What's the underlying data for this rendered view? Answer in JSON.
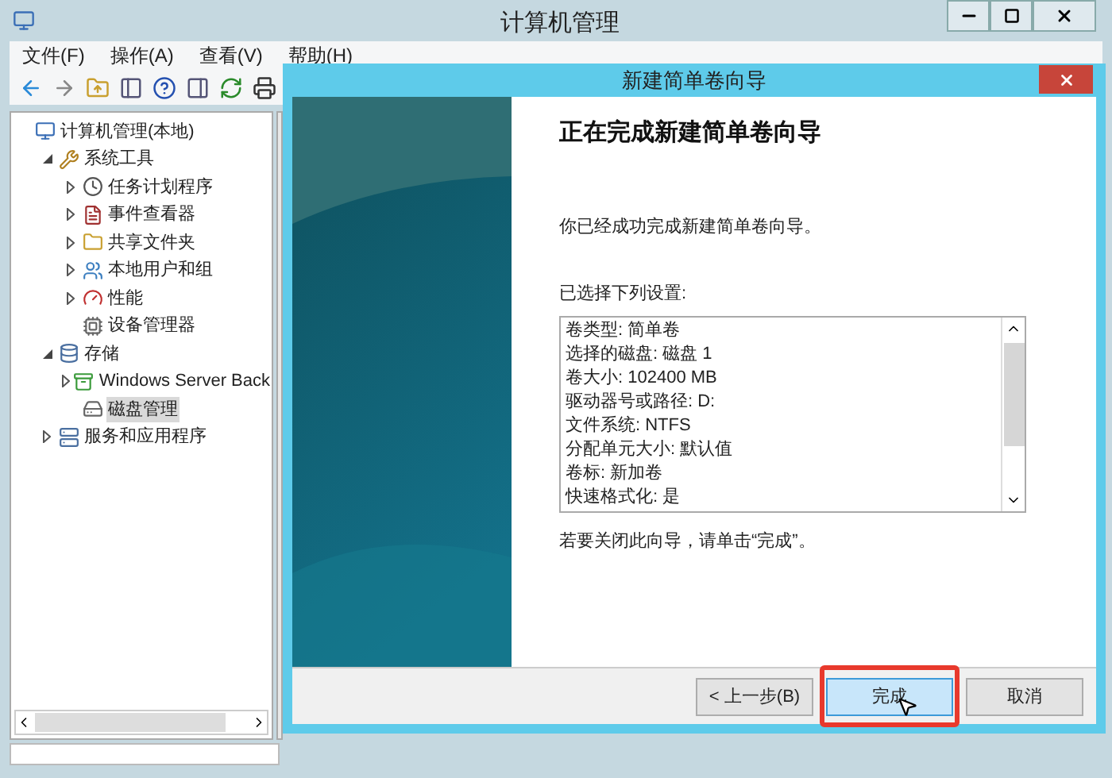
{
  "window": {
    "title": "计算机管理"
  },
  "menu": [
    "文件(F)",
    "操作(A)",
    "查看(V)",
    "帮助(H)"
  ],
  "tree": [
    {
      "label": "计算机管理(本地)",
      "selected": false,
      "children": [
        {
          "label": "系统工具",
          "expanded": true,
          "selected": false,
          "children": [
            {
              "label": "任务计划程序",
              "expanded": false,
              "selected": false
            },
            {
              "label": "事件查看器",
              "expanded": false,
              "selected": false
            },
            {
              "label": "共享文件夹",
              "expanded": false,
              "selected": false
            },
            {
              "label": "本地用户和组",
              "expanded": false,
              "selected": false
            },
            {
              "label": "性能",
              "expanded": false,
              "selected": false
            },
            {
              "label": "设备管理器",
              "selected": false
            }
          ]
        },
        {
          "label": "存储",
          "expanded": true,
          "selected": false,
          "children": [
            {
              "label": "Windows Server Back",
              "expanded": false,
              "selected": false
            },
            {
              "label": "磁盘管理",
              "selected": true
            }
          ]
        },
        {
          "label": "服务和应用程序",
          "expanded": false,
          "selected": false
        }
      ]
    }
  ],
  "dialog": {
    "title": "新建简单卷向导",
    "heading": "正在完成新建简单卷向导",
    "message": "你已经成功完成新建简单卷向导。",
    "settings_label": "已选择下列设置:",
    "settings": [
      "卷类型: 简单卷",
      "选择的磁盘: 磁盘 1",
      "卷大小: 102400 MB",
      "驱动器号或路径: D:",
      "文件系统: NTFS",
      "分配单元大小: 默认值",
      "卷标: 新加卷",
      "快速格式化: 是"
    ],
    "footer": "若要关闭此向导，请单击“完成”。",
    "buttons": [
      {
        "label": "< 上一步(B)",
        "kind": "normal",
        "highlighted": false
      },
      {
        "label": "完成",
        "kind": "default",
        "highlighted": true
      },
      {
        "label": "取消",
        "kind": "normal",
        "highlighted": false
      }
    ]
  }
}
